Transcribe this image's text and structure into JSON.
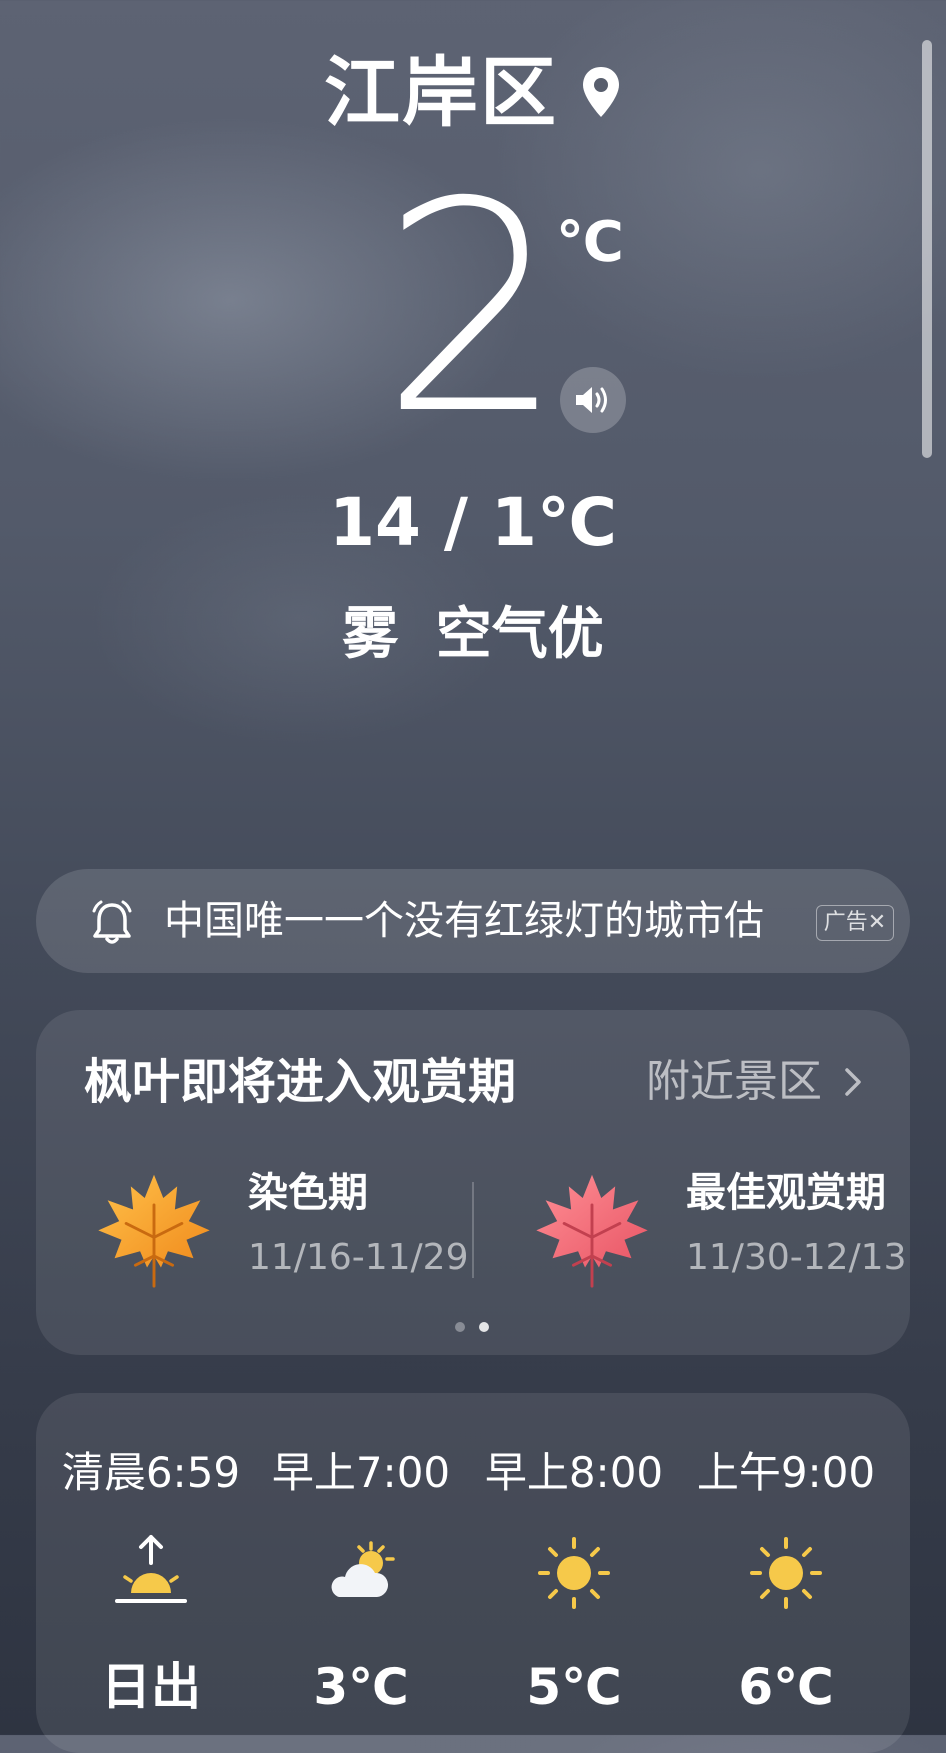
{
  "location": {
    "city": "江岸区",
    "icon": "location-pin-icon"
  },
  "current": {
    "temp": "2",
    "unit": "℃",
    "range": "14 / 1℃",
    "condition": "雾 空气优",
    "speaker_icon": "speaker-icon"
  },
  "ad": {
    "icon": "bell-icon",
    "text": "中国唯一一个没有红绿灯的城市估",
    "tag": "广告✕"
  },
  "maple": {
    "title": "枫叶即将进入观赏期",
    "link": "附近景区",
    "phases": [
      {
        "name": "染色期",
        "dates": "11/16-11/29",
        "icon": "orange-maple-leaf-icon",
        "color": "#f5a623"
      },
      {
        "name": "最佳观赏期",
        "dates": "11/30-12/13",
        "icon": "red-maple-leaf-icon",
        "color": "#f0707a"
      }
    ],
    "pager": {
      "count": 2,
      "active": 2
    }
  },
  "hourly": [
    {
      "time": "清晨6:59",
      "icon": "sunrise-icon",
      "value": "日出"
    },
    {
      "time": "早上7:00",
      "icon": "partly-cloudy-icon",
      "value": "3℃"
    },
    {
      "time": "早上8:00",
      "icon": "sun-icon",
      "value": "5℃"
    },
    {
      "time": "上午9:00",
      "icon": "sun-icon",
      "value": "6℃"
    }
  ],
  "colors": {
    "sun": "#f6c94a",
    "leaf_orange": "#f5a623",
    "leaf_red": "#f0707a"
  }
}
